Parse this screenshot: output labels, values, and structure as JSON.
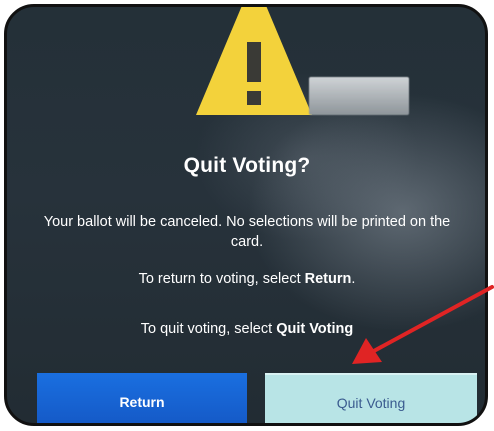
{
  "dialog": {
    "title": "Quit Voting?",
    "line1": "Your ballot will be canceled. No selections will be printed on the card.",
    "line2_prefix": "To return to voting, select ",
    "line2_emphasis": "Return",
    "line2_suffix": ".",
    "line3_prefix": "To quit voting, select ",
    "line3_emphasis": "Quit Voting",
    "line3_suffix": ""
  },
  "buttons": {
    "return_label": "Return",
    "quit_label": "Quit Voting"
  },
  "icons": {
    "warning": "warning-triangle-icon"
  },
  "colors": {
    "warning_yellow": "#f3d23b",
    "return_blue": "#1a6fe0",
    "quit_bg": "#b8e4e6",
    "arrow_red": "#e02424"
  }
}
